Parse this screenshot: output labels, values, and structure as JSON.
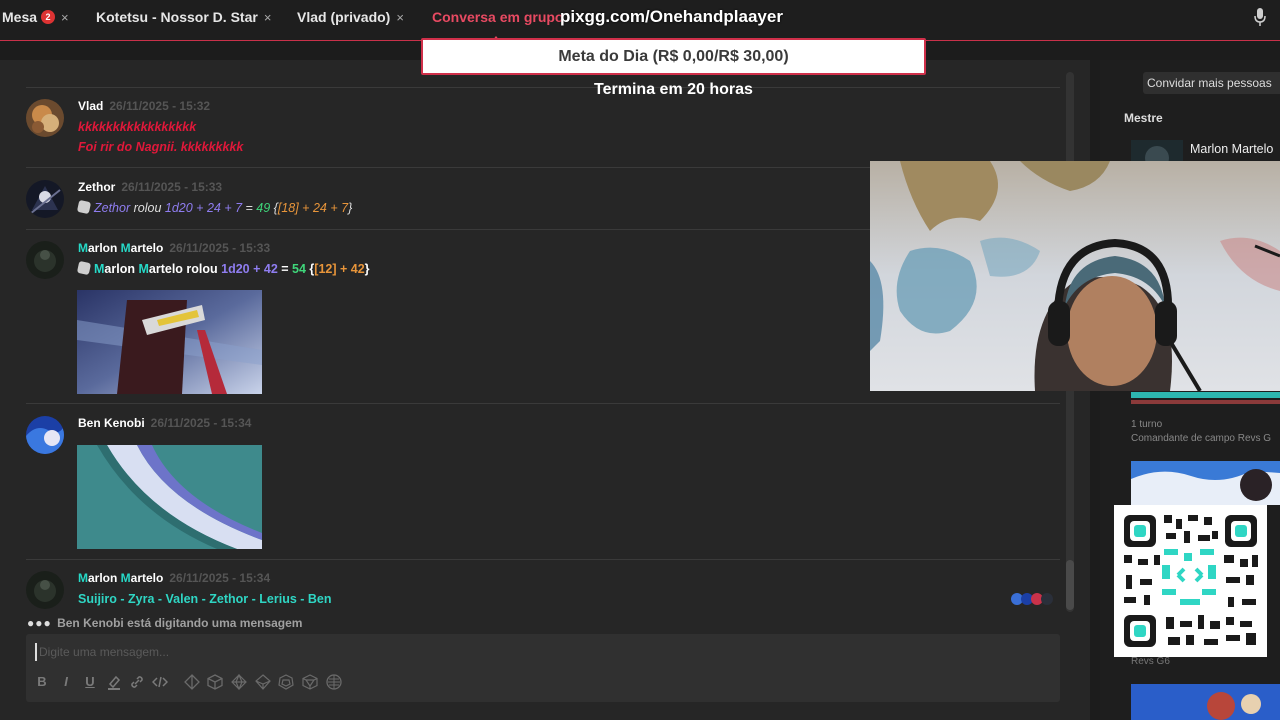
{
  "tabs": [
    {
      "label": "Mesa",
      "badge": "2",
      "close": "×"
    },
    {
      "label": "Kotetsu - Nossor D. Star",
      "close": "×"
    },
    {
      "label": "Vlad (privado)",
      "close": "×"
    },
    {
      "label": "Conversa em grupo",
      "close": ""
    }
  ],
  "overlay": {
    "url": "pixgg.com/Onehandplaayer",
    "goal": "Meta do Dia (R$ 0,00/R$ 30,00)",
    "ends": "Termina em 20 horas"
  },
  "messages": {
    "vlad": {
      "name": "Vlad",
      "time": "26/11/2025 - 15:32",
      "line1": "kkkkkkkkkkkkkkkkk",
      "line2": "Foi rir do Nagnii. kkkkkkkkk"
    },
    "zethor": {
      "name": "Zethor",
      "time": "26/11/2025 - 15:33",
      "who": "Zethor",
      "verb": " rolou ",
      "formula": "1d20 + 24 + 7",
      "eq": " = ",
      "result": "49",
      "open": " {",
      "detail": "[18] + 24 + 7",
      "close": "}"
    },
    "marlon1": {
      "name_m1": "M",
      "name_rest1": "arlon ",
      "name_m2": "M",
      "name_rest2": "artelo",
      "time": "26/11/2025 - 15:33",
      "verb": " rolou ",
      "formula": "1d20 + 42",
      "eq": " = ",
      "result": "54",
      "open": " {",
      "detail": "[12] + 42",
      "close": "}"
    },
    "ben": {
      "name": "Ben Kenobi",
      "time": "26/11/2025 - 15:34"
    },
    "marlon2": {
      "name_m1": "M",
      "name_rest1": "arlon ",
      "name_m2": "M",
      "name_rest2": "artelo",
      "time": "26/11/2025 - 15:34",
      "text": "Suijiro - Zyra - Valen - Zethor - Lerius - Ben"
    }
  },
  "typing": {
    "dots": "●●●",
    "text": "Ben Kenobi está digitando uma mensagem"
  },
  "composer": {
    "placeholder": "Digite uma mensagem..."
  },
  "toolbar_icons": [
    "bold-icon",
    "italic-icon",
    "underline-icon",
    "highlight-icon",
    "link-icon",
    "code-icon",
    "d4-icon",
    "d6-icon",
    "d8-icon",
    "d10-icon",
    "d12-icon",
    "d20-icon",
    "d100-icon"
  ],
  "sidebar": {
    "invite": "Convidar mais pessoas",
    "mestre_title": "Mestre",
    "mestre_name": "Marlon Martelo",
    "turn": "1 turno",
    "commander": "Comandante de campo Revs G",
    "revs": "Revs G6"
  },
  "colors": {
    "accent": "#e84a62",
    "name_highlight": "#26d9c7",
    "roll_formula": "#8f7df0",
    "roll_result": "#3fd67a",
    "roll_detail": "#e8953a",
    "laugh_text": "#e0183a"
  }
}
